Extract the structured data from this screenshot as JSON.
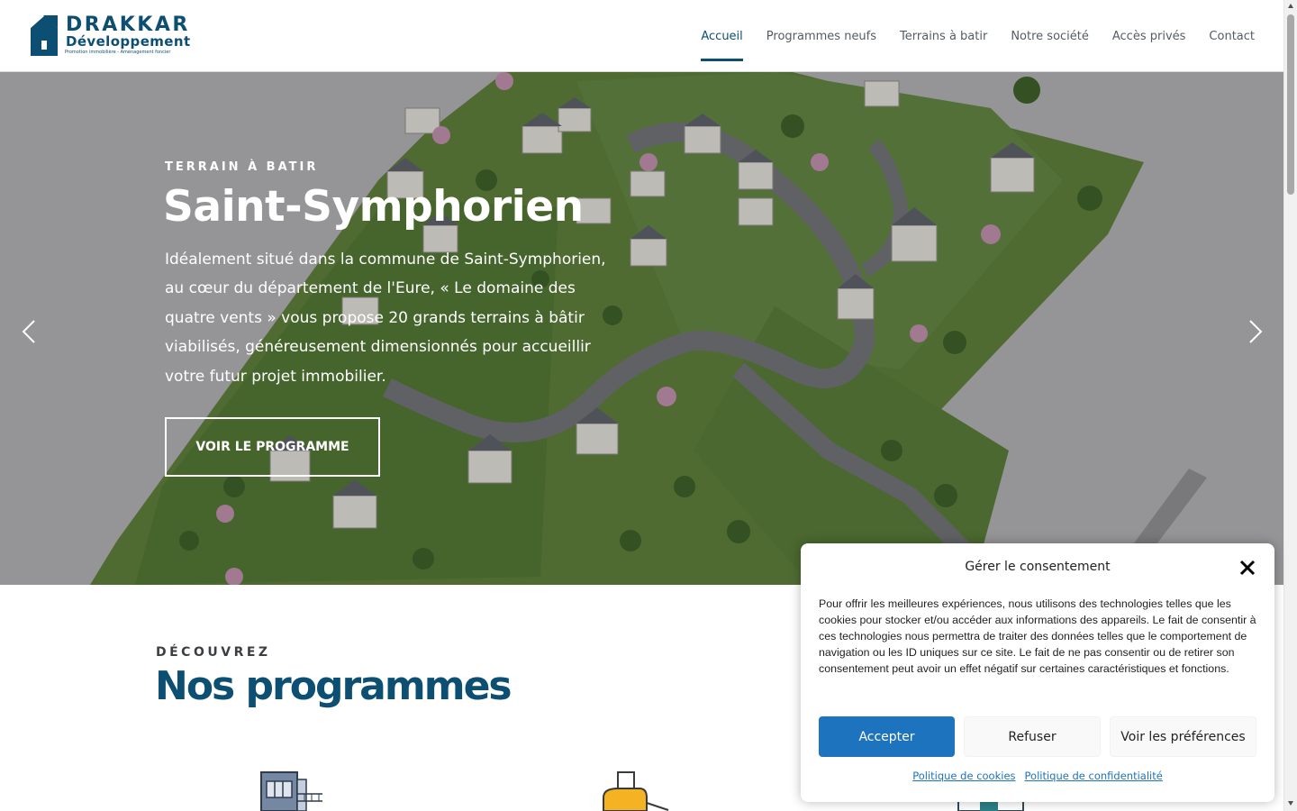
{
  "brand": {
    "name": "DRAKKAR",
    "sub": "Développement",
    "tagline": "Promotion immobilière - Aménagement foncier"
  },
  "nav": {
    "items": [
      {
        "label": "Accueil",
        "active": true
      },
      {
        "label": "Programmes neufs",
        "active": false
      },
      {
        "label": "Terrains à batir",
        "active": false
      },
      {
        "label": "Notre société",
        "active": false
      },
      {
        "label": "Accès privés",
        "active": false
      },
      {
        "label": "Contact",
        "active": false
      }
    ]
  },
  "hero": {
    "eyebrow": "TERRAIN À BATIR",
    "title": "Saint-Symphorien",
    "text": "Idéalement situé dans la commune de Saint-Symphorien, au cœur du département de l'Eure, « Le domaine des quatre vents » vous propose 20 grands terrains à bâtir viabilisés, généreusement dimensionnés pour accueillir votre futur projet immobilier.",
    "button": "VOIR LE PROGRAMME",
    "prev_icon": "chevron-left-icon",
    "next_icon": "chevron-right-icon"
  },
  "section": {
    "eyebrow": "DÉCOUVREZ",
    "title": "Nos programmes",
    "icons": [
      "apartment-building-icon",
      "construction-icon",
      "house-plan-icon"
    ]
  },
  "consent": {
    "title": "Gérer le consentement",
    "body": "Pour offrir les meilleures expériences, nous utilisons des technologies telles que les cookies pour stocker et/ou accéder aux informations des appareils. Le fait de consentir à ces technologies nous permettra de traiter des données telles que le comportement de navigation ou les ID uniques sur ce site. Le fait de ne pas consentir ou de retirer son consentement peut avoir un effet négatif sur certaines caractéristiques et fonctions.",
    "accept": "Accepter",
    "deny": "Refuser",
    "prefs": "Voir les préférences",
    "link_cookies": "Politique de cookies",
    "link_privacy": "Politique de confidentialité"
  },
  "colors": {
    "brand": "#0d4f72",
    "accept_button": "#1e73be",
    "nav_text": "#555c63"
  }
}
